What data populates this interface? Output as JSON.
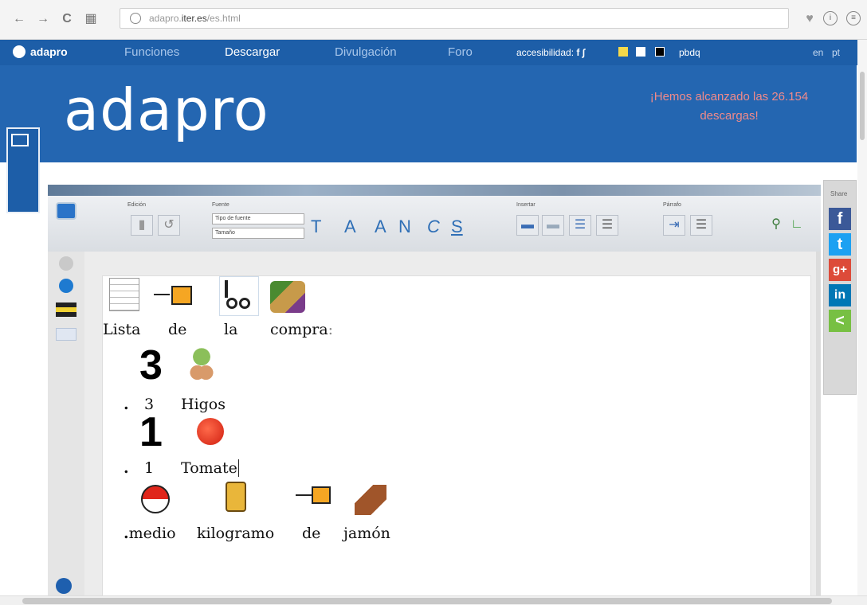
{
  "browser": {
    "url_prefix": "adapro.",
    "url_host": "iter.es",
    "url_path": "/es.html"
  },
  "nav": {
    "logo": "adapro",
    "items": [
      "Funciones",
      "Descargar",
      "Divulgación",
      "Foro"
    ],
    "accessibility_label": "accesibilidad:",
    "acc_fonts": [
      "f",
      "∫"
    ],
    "pbdq": "pbdq",
    "langs": [
      "en",
      "pt"
    ]
  },
  "hero": {
    "logo": "adapro",
    "message": "¡Hemos alcanzado las 26.154 descargas!"
  },
  "ribbon": {
    "groups": [
      "Edición",
      "Fuente",
      "Insertar",
      "Párrafo"
    ],
    "font_type_label": "Tipo de fuente",
    "font_size_label": "Tamaño",
    "format_letters": [
      "T",
      "A",
      "A",
      "N",
      "C",
      "S"
    ]
  },
  "document": {
    "line1": [
      "Lista",
      "de",
      "la",
      "compra"
    ],
    "line1_punct": ":",
    "line2_num": "3",
    "line2_bullet": ".",
    "line2_words": [
      "3",
      "Higos"
    ],
    "line3_num": "1",
    "line3_bullet": ".",
    "line3_words": [
      "1",
      "Tomate"
    ],
    "line4_bullet": ".",
    "line4_words": [
      "medio",
      "kilogramo",
      "de",
      "jamón"
    ]
  },
  "share": {
    "label": "Share",
    "buttons": [
      {
        "label": "f",
        "color": "#3b5998"
      },
      {
        "label": "t",
        "color": "#1da1f2"
      },
      {
        "label": "g+",
        "color": "#dd4b39"
      },
      {
        "label": "in",
        "color": "#0077b5"
      },
      {
        "label": "<",
        "color": "#77c043"
      }
    ]
  },
  "colors": {
    "brand": "#2466b1",
    "nav": "#1d5ea8",
    "pictogram_orange": "#f5a623"
  }
}
